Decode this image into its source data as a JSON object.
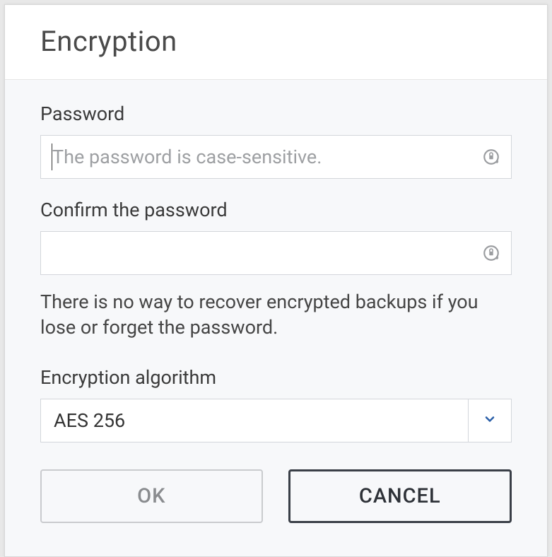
{
  "dialog": {
    "title": "Encryption"
  },
  "password": {
    "label": "Password",
    "placeholder": "The password is case-sensitive.",
    "value": ""
  },
  "confirm": {
    "label": "Confirm the password",
    "placeholder": "",
    "value": ""
  },
  "helper": "There is no way to recover encrypted backups if you lose or forget the password.",
  "algorithm": {
    "label": "Encryption algorithm",
    "selected": "AES 256"
  },
  "buttons": {
    "ok": "OK",
    "cancel": "CANCEL"
  }
}
